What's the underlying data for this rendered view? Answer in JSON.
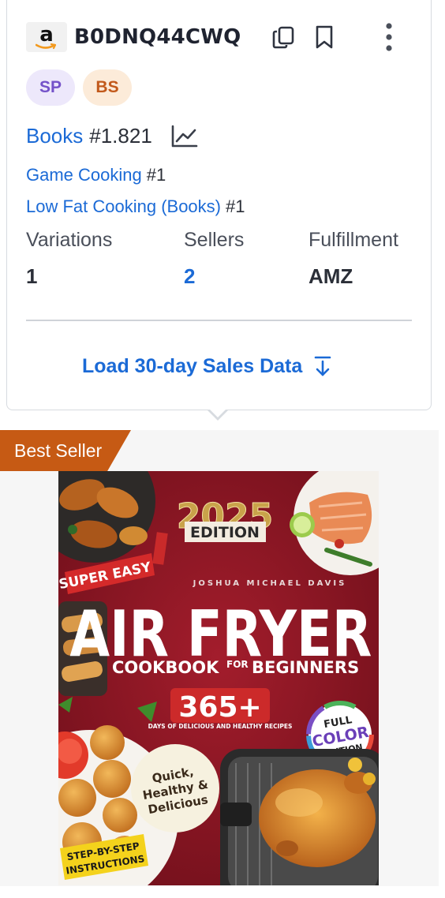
{
  "product": {
    "marketplace_logo_letter": "a",
    "asin": "B0DNQ44CWQ",
    "badges": [
      "SP",
      "BS"
    ]
  },
  "rankings": {
    "main_category": "Books",
    "main_rank": "#1.821",
    "sub": [
      {
        "category": "Game Cooking",
        "rank": "#1"
      },
      {
        "category": "Low Fat Cooking (Books)",
        "rank": "#1"
      }
    ]
  },
  "stats": {
    "variations": {
      "label": "Variations",
      "value": "1"
    },
    "sellers": {
      "label": "Sellers",
      "value": "2"
    },
    "fulfillment": {
      "label": "Fulfillment",
      "value": "AMZ"
    }
  },
  "actions": {
    "load_sales": "Load 30-day Sales Data"
  },
  "listing": {
    "tag": "Best Seller"
  },
  "cover": {
    "year": "2025",
    "edition": "EDITION",
    "super_easy": "SUPER EASY",
    "author": "JOSHUA MICHAEL DAVIS",
    "title": "AIR FRYER",
    "subtitle_a": "COOKBOOK",
    "subtitle_for": "FOR",
    "subtitle_b": "BEGINNERS",
    "count": "365+",
    "days_text": "DAYS OF DELICIOUS AND HEALTHY RECIPES",
    "full": "FULL",
    "color": "COLOR",
    "edition2": "EDITION",
    "quick1": "Quick,",
    "quick2": "Healthy &",
    "quick3": "Delicious",
    "step1": "STEP-BY-STEP",
    "step2": "INSTRUCTIONS"
  },
  "colors": {
    "link": "#1b6ad6",
    "sp_badge_bg": "#ede8fb",
    "bs_badge_bg": "#fcebd9",
    "best_seller_tag": "#c65a14",
    "cover_bg": "#8f1522"
  }
}
